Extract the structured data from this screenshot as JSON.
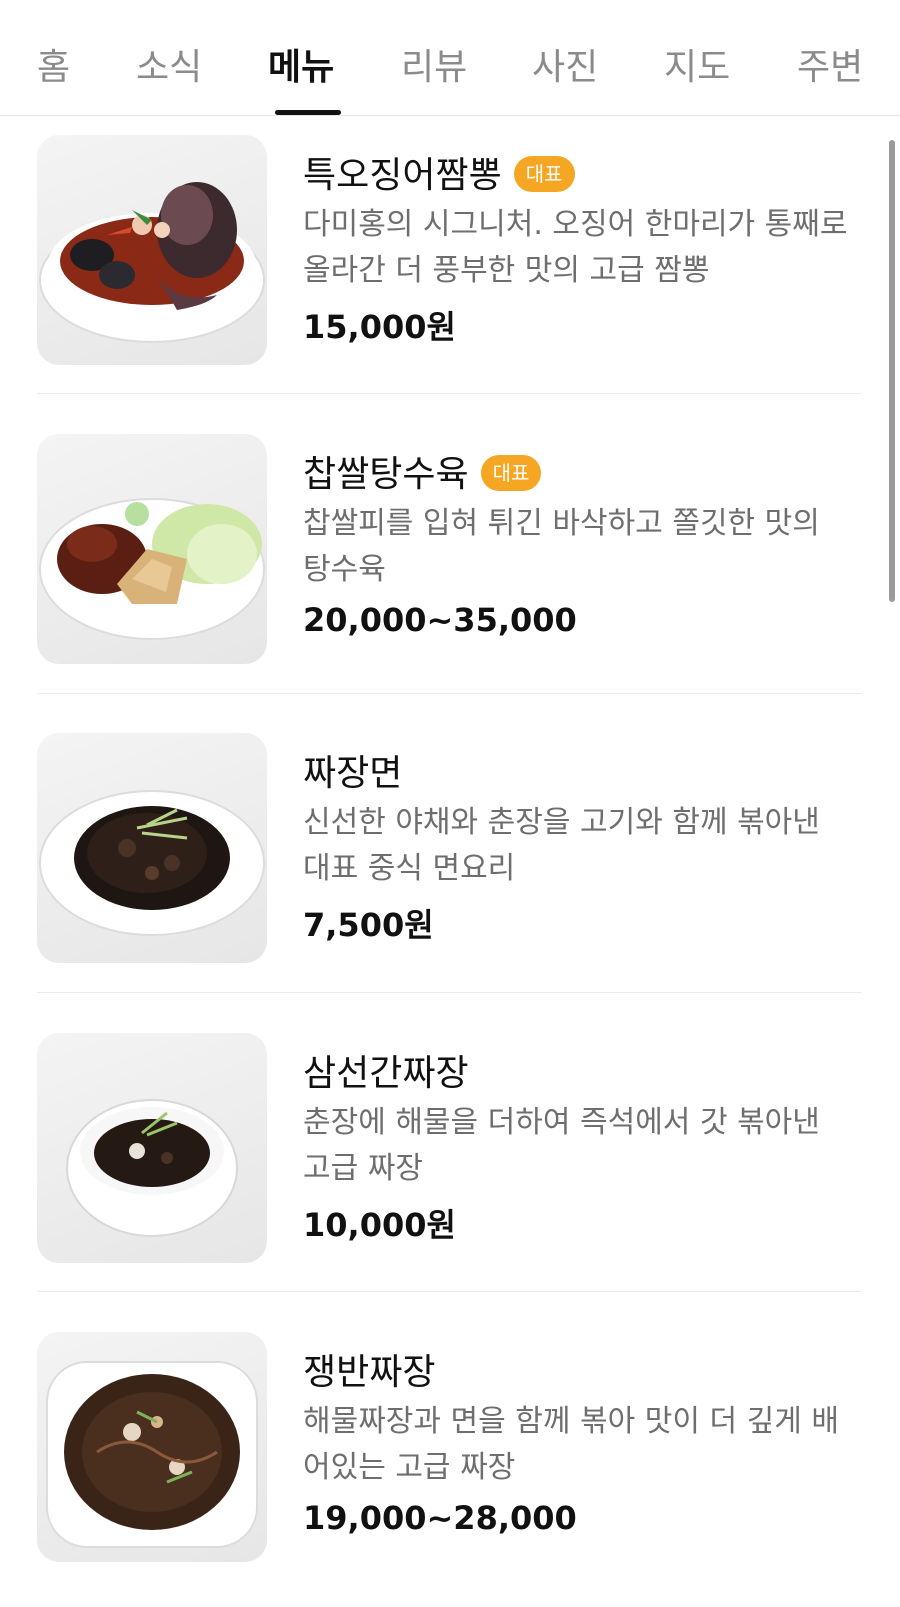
{
  "tabs": [
    {
      "label": "홈",
      "active": false
    },
    {
      "label": "소식",
      "active": false
    },
    {
      "label": "메뉴",
      "active": true
    },
    {
      "label": "리뷰",
      "active": false
    },
    {
      "label": "사진",
      "active": false
    },
    {
      "label": "지도",
      "active": false
    },
    {
      "label": "주변",
      "active": false
    }
  ],
  "colors": {
    "badge": "#f5a623",
    "active_tab": "#111111",
    "inactive_tab": "#8b8b8b"
  },
  "menu": {
    "items": [
      {
        "name": "특오징어짬뽕",
        "badge": "대표",
        "description": "다미홍의 시그니처. 오징어 한마리가 통째로 올라간 더 풍부한 맛의 고급 짬뽕",
        "price": "15,000원",
        "image": "squid-jjamppong-photo"
      },
      {
        "name": "찹쌀탕수육",
        "badge": "대표",
        "description": "찹쌀피를 입혀 튀긴 바삭하고 쫄깃한 맛의 탕수육",
        "price": "20,000~35,000",
        "image": "sweet-sour-pork-photo"
      },
      {
        "name": "짜장면",
        "description": "신선한 야채와 춘장을 고기와 함께 볶아낸 대표 중식 면요리",
        "price": "7,500원",
        "image": "jajangmyeon-photo"
      },
      {
        "name": "삼선간짜장",
        "description": "춘장에 해물을 더하여 즉석에서 갓 볶아낸 고급 짜장",
        "price": "10,000원",
        "image": "seafood-ganjjajang-photo"
      },
      {
        "name": "쟁반짜장",
        "description": "해물짜장과 면을 함께 볶아 맛이 더 깊게 배어있는 고급 짜장",
        "price": "19,000~28,000",
        "image": "tray-jjajang-photo"
      }
    ]
  }
}
